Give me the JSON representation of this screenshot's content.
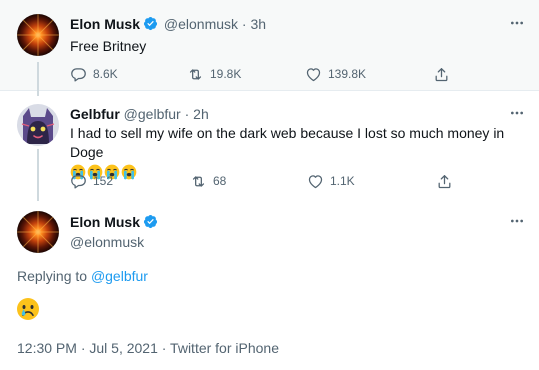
{
  "tweets": [
    {
      "name": "Elon Musk",
      "handle": "@elonmusk",
      "time": "3h",
      "text": "Free Britney",
      "replies": "8.6K",
      "retweets": "19.8K",
      "likes": "139.8K"
    },
    {
      "name": "Gelbfur",
      "handle": "@gelbfur",
      "time": "2h",
      "text": "I had to sell my wife on the dark web because I lost so much money in Doge",
      "emojis": [
        "crying-face-emoji",
        "crying-face-emoji",
        "crying-face-emoji",
        "crying-face-emoji"
      ],
      "replies": "152",
      "retweets": "68",
      "likes": "1.1K"
    }
  ],
  "main_tweet": {
    "name": "Elon Musk",
    "handle": "@elonmusk",
    "replying_prefix": "Replying to",
    "replying_to": "@gelbfur",
    "emoji": "crying-face-emoji",
    "timestamp": "12:30 PM · Jul 5, 2021 · Twitter for iPhone"
  },
  "colors": {
    "accent": "#1d9bf0",
    "muted_text": "#536471",
    "highlight_bg": "#f7f9f9"
  },
  "separator": " · "
}
